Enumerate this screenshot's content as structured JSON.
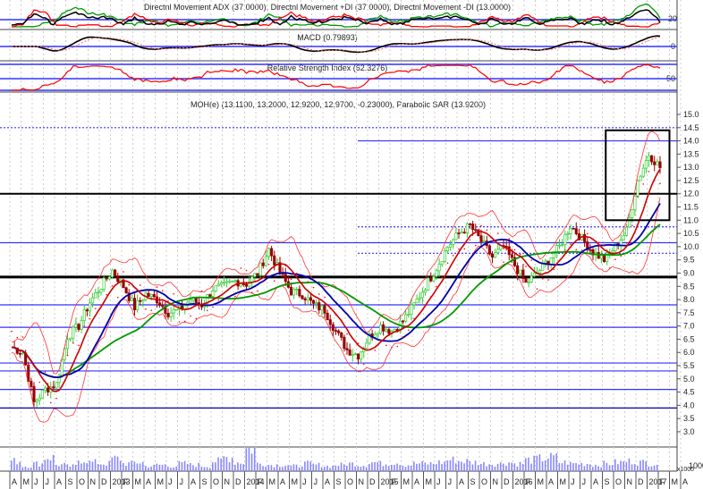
{
  "chart_data": {
    "type": "line",
    "panels": {
      "adx": {
        "title": "Directnl Movement ADX (37.0000), Directnl Movement +DI (37.0000), Directnl Movement -DI (13.0000)",
        "tick": "20"
      },
      "macd": {
        "title": "MACD (0.79893)",
        "tick": "0"
      },
      "rsi": {
        "title": "Relative Strength Index (62.3276)",
        "tick": "50"
      },
      "price": {
        "title": "MOH(e) (13.1100, 13.2000, 12.9200, 12.9700, -0.23000), Parabolic SAR (13.9200)"
      }
    },
    "yticks": [
      "15.0",
      "14.5",
      "14.0",
      "13.5",
      "13.0",
      "12.5",
      "12.0",
      "11.5",
      "11.0",
      "10.5",
      "10.0",
      "9.5",
      "9.0",
      "8.5",
      "8.0",
      "7.5",
      "7.0",
      "6.5",
      "6.0",
      "5.5",
      "5.0",
      "4.5",
      "4.0",
      "3.5",
      "3.0"
    ],
    "ylim": [
      3.0,
      15.0
    ],
    "volume_label": "x1000",
    "volume_tick": "1000",
    "xticks": [
      "A",
      "M",
      "J",
      "J",
      "A",
      "S",
      "O",
      "N",
      "D",
      "2013",
      "F",
      "M",
      "A",
      "M",
      "J",
      "J",
      "A",
      "S",
      "O",
      "N",
      "D",
      "2014",
      "F",
      "M",
      "A",
      "M",
      "J",
      "J",
      "A",
      "S",
      "O",
      "N",
      "D",
      "2015",
      "F",
      "M",
      "A",
      "M",
      "J",
      "J",
      "A",
      "S",
      "O",
      "N",
      "D",
      "2016",
      "F",
      "M",
      "A",
      "M",
      "J",
      "J",
      "A",
      "S",
      "O",
      "N",
      "D",
      "2017",
      "F",
      "M",
      "A"
    ],
    "monthly_close": [
      6.2,
      6.0,
      4.1,
      4.6,
      4.8,
      6.6,
      7.0,
      7.9,
      8.5,
      9.1,
      8.5,
      7.7,
      8.2,
      8.0,
      7.5,
      7.6,
      8.0,
      7.8,
      8.4,
      8.5,
      8.7,
      8.6,
      9.0,
      9.9,
      9.0,
      8.3,
      8.2,
      7.8,
      7.6,
      6.8,
      6.1,
      5.9,
      6.6,
      7.0,
      6.8,
      7.2,
      7.8,
      8.5,
      9.2,
      10.0,
      10.5,
      10.8,
      10.2,
      9.6,
      10.0,
      9.3,
      8.6,
      9.0,
      9.5,
      10.0,
      10.8,
      10.3,
      9.8,
      9.5,
      10.0,
      10.6,
      12.5,
      13.5,
      13.0
    ],
    "monthly_volume": [
      40,
      20,
      30,
      55,
      25,
      20,
      45,
      35,
      30,
      50,
      30,
      35,
      20,
      25,
      20,
      30,
      25,
      20,
      40,
      55,
      35,
      90,
      30,
      25,
      25,
      20,
      30,
      25,
      20,
      25,
      30,
      25,
      35,
      30,
      35,
      25,
      30,
      30,
      35,
      45,
      40,
      35,
      30,
      30,
      35,
      30,
      45,
      50,
      55,
      35,
      30,
      30,
      25,
      30,
      35,
      40,
      35,
      30,
      25
    ],
    "hlines": [
      {
        "value": 14.5,
        "style": "dotted",
        "color": "#3333ff"
      },
      {
        "value": 14.0,
        "style": "solid",
        "color": "#3333ff"
      },
      {
        "value": 12.0,
        "style": "thick",
        "color": "#000000"
      },
      {
        "value": 10.75,
        "style": "dotted",
        "color": "#3333ff"
      },
      {
        "value": 10.15,
        "style": "solid",
        "color": "#3333ff"
      },
      {
        "value": 9.75,
        "style": "dotted",
        "color": "#3333ff"
      },
      {
        "value": 8.85,
        "style": "thicker",
        "color": "#000000"
      },
      {
        "value": 7.8,
        "style": "solid",
        "color": "#3333ff"
      },
      {
        "value": 6.95,
        "style": "solid",
        "color": "#3333ff"
      },
      {
        "value": 5.6,
        "style": "solid",
        "color": "#3333ff"
      },
      {
        "value": 5.3,
        "style": "solid",
        "color": "#3333ff"
      },
      {
        "value": 4.6,
        "style": "solid",
        "color": "#3333ff"
      },
      {
        "value": 3.9,
        "style": "solid",
        "color": "#0000aa"
      }
    ],
    "highlight_box": {
      "x_months": [
        53.3,
        59.0
      ],
      "y": [
        11.0,
        14.4
      ]
    },
    "colors": {
      "up": "#33cc33",
      "down": "#990000",
      "ma_short": "#cc0000",
      "ma_mid": "#0000aa",
      "ma_long": "#009900",
      "band": "#ff3333",
      "sar": "#ff0000"
    }
  }
}
